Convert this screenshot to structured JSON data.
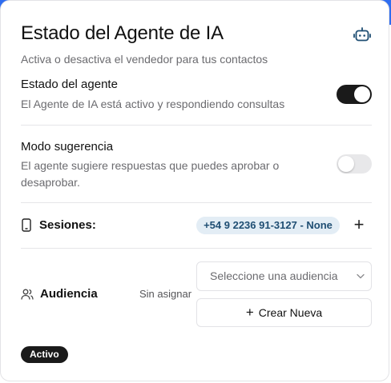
{
  "header": {
    "title": "Estado del Agente de IA",
    "subtitle": "Activa o desactiva el vendedor para tus contactos",
    "icon": "robot-icon",
    "bar_color": "#2f6df0"
  },
  "agent_status": {
    "label": "Estado del agente",
    "description": "El Agente de IA está activo y respondiendo consultas",
    "enabled": true
  },
  "suggestion_mode": {
    "label": "Modo sugerencia",
    "description": "El agente sugiere respuestas que puedes aprobar o desaprobar.",
    "enabled": false
  },
  "sessions": {
    "label": "Sesiones:",
    "icon": "phone-icon",
    "items": [
      "+54 9 2236 91-3127 - None"
    ],
    "add_icon": "plus-icon"
  },
  "audience": {
    "label": "Audiencia",
    "icon": "users-icon",
    "current": "Sin asignar",
    "select_placeholder": "Seleccione una audiencia",
    "create_label": "Crear Nueva"
  },
  "status": {
    "badge": "Activo"
  }
}
